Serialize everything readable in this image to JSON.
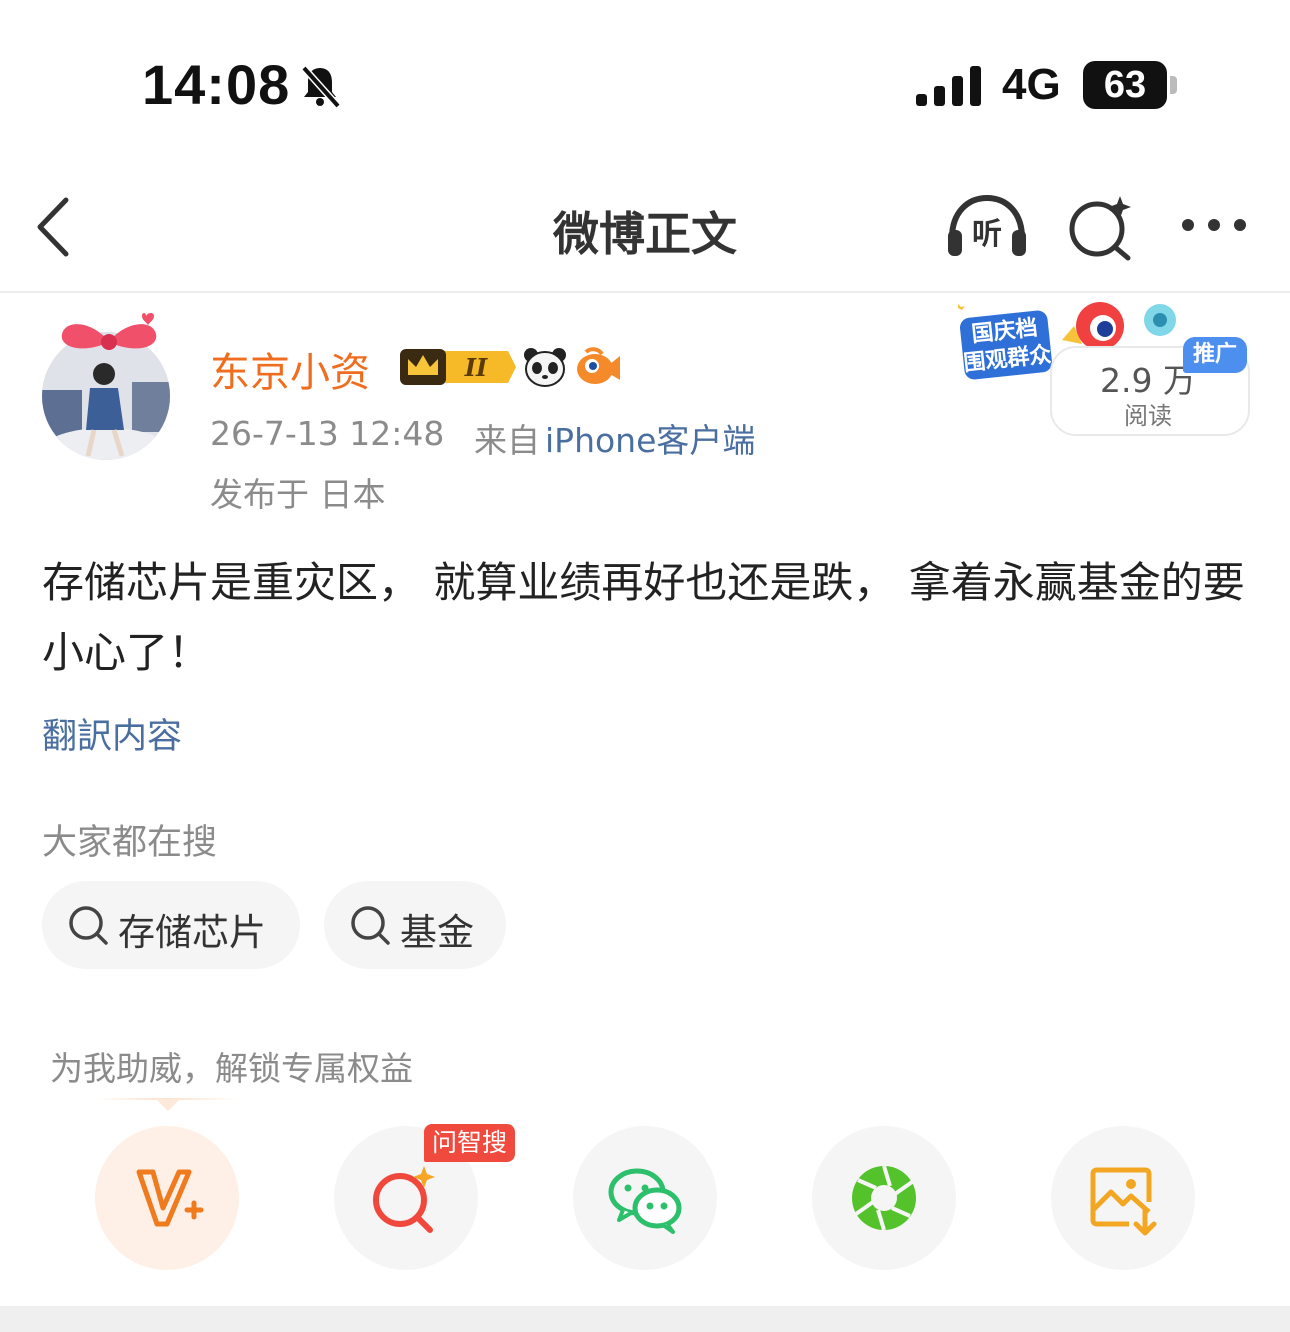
{
  "status_bar": {
    "time": "14:08",
    "network": "4G",
    "battery": "63",
    "icons": [
      "bell-muted-icon",
      "signal-icon",
      "battery-icon"
    ]
  },
  "nav": {
    "title": "微博正文",
    "listen_label": "听",
    "icons": [
      "back-icon",
      "listen-icon",
      "ai-search-icon",
      "more-icon"
    ]
  },
  "author": {
    "name": "东京小资",
    "crown_level": "II",
    "time": "26-7-13 12:48",
    "from_prefix": "来自",
    "client": "iPhone客户端",
    "location": "发布于 日本",
    "colors": {
      "name": "#f06d1f",
      "link": "#4a6ea0"
    }
  },
  "promo": {
    "line1": "国庆档",
    "line2": "围观群众",
    "ad_tag": "推广",
    "reads_count": "2.9 万",
    "reads_label": "阅读"
  },
  "post": {
    "text": "存储芯片是重灾区， 就算业绩再好也还是跌， 拿着永赢基金的要小心了！",
    "translate_label": "翻訳内容"
  },
  "hot_search": {
    "title": "大家都在搜",
    "chips": [
      {
        "label": "存储芯片",
        "icon": "search-icon"
      },
      {
        "label": "基金",
        "icon": "search-icon"
      }
    ]
  },
  "support": {
    "title": "为我助威，解锁专属权益",
    "ask_tag": "问智搜",
    "actions": [
      {
        "name": "v-plus",
        "icon": "v-plus-icon",
        "color": "#f07a1e"
      },
      {
        "name": "ai-search",
        "icon": "ai-search-icon",
        "color": "#f0483c"
      },
      {
        "name": "wechat",
        "icon": "wechat-icon",
        "color": "#2cbf6c"
      },
      {
        "name": "moments",
        "icon": "moments-icon",
        "color": "#53c22b"
      },
      {
        "name": "save-image",
        "icon": "save-image-icon",
        "color": "#f2a622"
      }
    ]
  }
}
